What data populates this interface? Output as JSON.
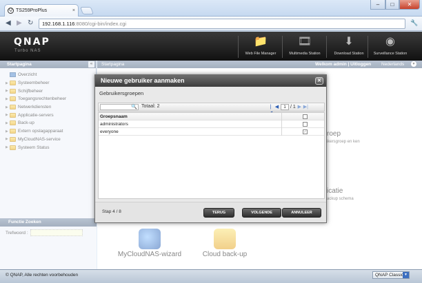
{
  "browser": {
    "tab_title": "TS259ProPlus",
    "tab_close": "×",
    "favicon": "Q",
    "url_host": "192.168.1.116",
    "url_rest": ":8080/cgi-bin/index.cgi",
    "window_controls": {
      "minimize": "–",
      "maximize": "□",
      "close": "✕"
    }
  },
  "header": {
    "logo": "QNAP",
    "logo_sub": "Turbo NAS",
    "stations": [
      {
        "label": "Web File Manager"
      },
      {
        "label": "Multimedia Station"
      },
      {
        "label": "Download Station"
      },
      {
        "label": "Surveillance Station"
      }
    ]
  },
  "sidebar": {
    "title": "Startpagina",
    "items": [
      {
        "label": "Overzicht"
      },
      {
        "label": "Systeembeheer"
      },
      {
        "label": "Schijfbeheer"
      },
      {
        "label": "Toegangsrechtenbeheer"
      },
      {
        "label": "Netwerkdiensten"
      },
      {
        "label": "Applicatie-servers"
      },
      {
        "label": "Back-up"
      },
      {
        "label": "Extern opslagapparaat"
      },
      {
        "label": "MyCloudNAS-service"
      },
      {
        "label": "Systeem Status"
      }
    ],
    "search_title": "Functie Zoeken",
    "search_label": "Trefwoord :"
  },
  "main": {
    "title": "Startpagina",
    "welcome": "Welkom admin | Uitloggen",
    "language": "Nederlands",
    "bg_title_1": "roep",
    "bg_sub_1": "ikersgroep en ken",
    "bg_title_2": "icatie",
    "bg_sub_2": "ackup schema",
    "wizards": [
      {
        "label": "MyCloudNAS-wizard"
      },
      {
        "label": "Cloud back-up"
      }
    ]
  },
  "modal": {
    "title": "Nieuwe gebruiker aanmaken",
    "close": "✕",
    "section": "Gebruikersgroepen",
    "total": "Totaal: 2",
    "page_value": "1",
    "page_of": "/ 1",
    "column_header": "Groepsnaam",
    "rows": [
      {
        "name": "administrators",
        "checked": ""
      },
      {
        "name": "everyone",
        "checked": "✓"
      }
    ],
    "step": "Stap 4 / 8",
    "back": "TERUG",
    "next": "VOLGENDE",
    "cancel": "ANNULEER"
  },
  "footer": {
    "copyright": "© QNAP, Alle rechten voorbehouden",
    "mode": "QNAP Classic"
  }
}
